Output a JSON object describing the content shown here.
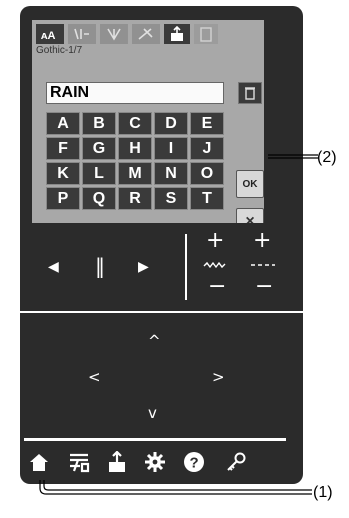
{
  "screen": {
    "font_label": "Gothic-1/7",
    "text_value": "RAIN",
    "keys": [
      "A",
      "B",
      "C",
      "D",
      "E",
      "F",
      "G",
      "H",
      "I",
      "J",
      "K",
      "L",
      "M",
      "N",
      "O",
      "P",
      "Q",
      "R",
      "S",
      "T"
    ],
    "ok_label": "OK",
    "cancel_label": "×"
  },
  "controls": {
    "left_arrow": "◀",
    "pause": "‖",
    "right_arrow": "▶",
    "plus_left": "+",
    "plus_right": "+",
    "minus_left": "−",
    "minus_right": "−",
    "up": "^",
    "left": "<",
    "right": ">",
    "down": "v"
  },
  "bottom_icons": [
    "home-icon",
    "threading-icon",
    "export-icon",
    "settings-icon",
    "help-icon",
    "key-icon"
  ],
  "callouts": {
    "one": "(1)",
    "two": "(2)"
  },
  "colors": {
    "panel": "#2b2b2b",
    "screen": "#a8a8a8",
    "key_bg": "#3a3a3a"
  }
}
